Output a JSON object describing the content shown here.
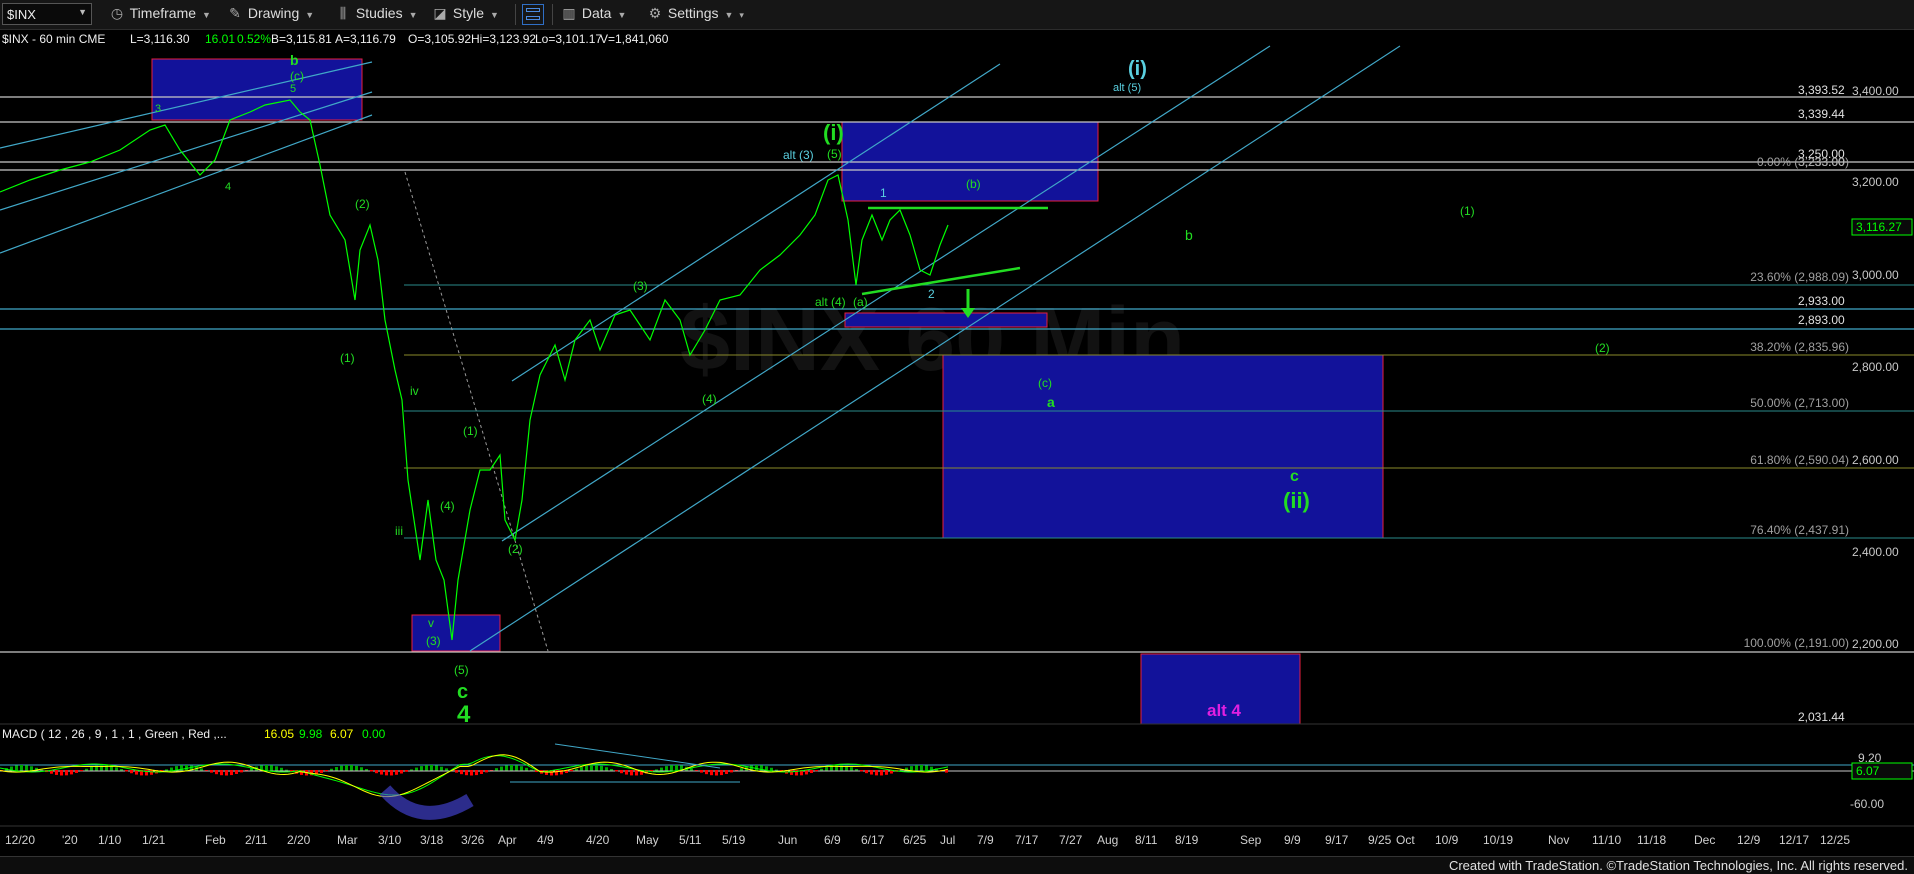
{
  "toolbar": {
    "symbol": "$INX",
    "timeframe": "Timeframe",
    "drawing": "Drawing",
    "studies": "Studies",
    "style": "Style",
    "data": "Data",
    "settings": "Settings"
  },
  "header": {
    "title": "$INX - 60 min  CME",
    "last": "L=3,116.30",
    "change": "16.01",
    "pct": "0.52%",
    "bid": "B=3,115.81",
    "ask": "A=3,116.79",
    "open": "O=3,105.92",
    "high": "Hi=3,123.92",
    "low": "Lo=3,101.17",
    "volume": "V=1,841,060"
  },
  "price_axis": {
    "ticks": [
      "3,400.00",
      "3,200.00",
      "3,000.00",
      "2,800.00",
      "2,600.00",
      "2,400.00",
      "2,200.00"
    ],
    "levels": [
      "3,393.52",
      "3,339.44",
      "3,250.00",
      "3,233.00",
      "2,933.00",
      "2,893.00",
      "2,031.44"
    ],
    "last_price": "3,116.27",
    "last_price_color": "#00ff00"
  },
  "fib_labels": [
    "0.00% (3,233.00)",
    "23.60% (2,988.09)",
    "38.20% (2,835.96)",
    "50.00% (2,713.00)",
    "61.80% (2,590.04)",
    "76.40% (2,437.91)",
    "100.00% (2,191.00)"
  ],
  "wave_labels": {
    "green": [
      "b",
      "(c)",
      "5",
      "3",
      "4",
      "(2)",
      "(1)",
      "iv",
      "iii",
      "(4)",
      "(1)",
      "(2)",
      "v",
      "(3)",
      "(5)",
      "c",
      "4",
      "(3)",
      "(4)",
      "(i)",
      "(5)",
      "alt (4)",
      "(a)",
      "1",
      "2",
      "(b)",
      "b",
      "(1)",
      "(2)",
      "(c)",
      "a",
      "c",
      "(ii)"
    ],
    "cyan": [
      "(i)",
      "alt (5)",
      "alt (3)"
    ],
    "magenta": "alt 4"
  },
  "macd": {
    "label": "MACD ( 12 , 26 , 9 , 1 , 1 , Green , Red ,...",
    "v1": "16.05",
    "v2": "9.98",
    "v3": "6.07",
    "v4": "0.00",
    "axis_top": "9.20",
    "axis_cur": "6.07",
    "axis_bottom": "-60.00",
    "colors": {
      "macd": "#00ff00",
      "signal": "#ffff00",
      "hist_up": "#00aa00",
      "hist_down": "#ff0000"
    }
  },
  "time_axis": [
    "12/20",
    "'20",
    "1/10",
    "1/21",
    "Feb",
    "2/11",
    "2/20",
    "Mar",
    "3/10",
    "3/18",
    "3/26",
    "Apr",
    "4/9",
    "4/20",
    "May",
    "5/11",
    "5/19",
    "Jun",
    "6/9",
    "6/17",
    "6/25",
    "Jul",
    "7/9",
    "7/17",
    "7/27",
    "Aug",
    "8/11",
    "8/19",
    "Sep",
    "9/9",
    "9/17",
    "9/25",
    "Oct",
    "10/9",
    "10/19",
    "Nov",
    "11/10",
    "11/18",
    "Dec",
    "12/9",
    "12/17",
    "12/25"
  ],
  "footer": "Created with TradeStation. ©TradeStation Technologies, Inc. All rights reserved.",
  "colors": {
    "background": "#000000",
    "price": "#00ff00",
    "channel": "#41a8c8",
    "box_fill": "#12129a",
    "box_border": "#e81e3c",
    "fib": "#2a8a8a"
  }
}
